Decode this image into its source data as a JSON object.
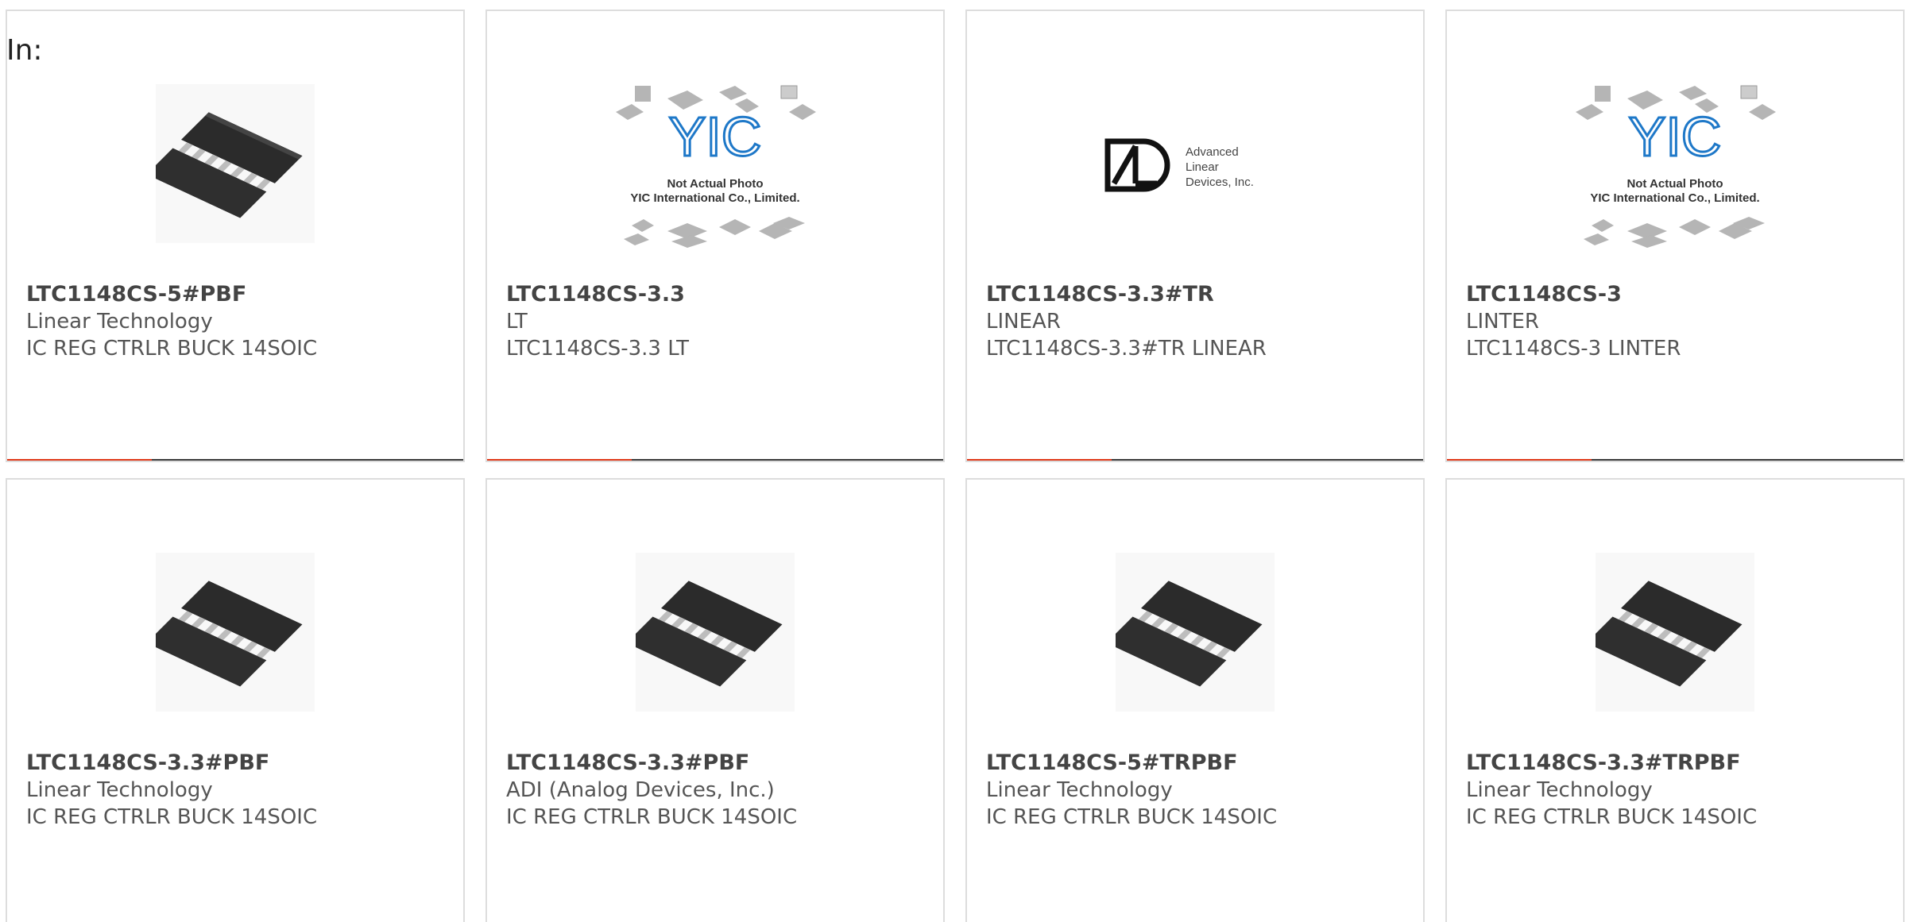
{
  "filter": {
    "in_label": "In:"
  },
  "products": [
    {
      "part": "LTC1148CS-5#PBF",
      "maker": "Linear Technology",
      "desc": "IC REG CTRLR BUCK 14SOIC",
      "image": "chip-icon"
    },
    {
      "part": "LTC1148CS-3.3",
      "maker": "LT",
      "desc": "LTC1148CS-3.3 LT",
      "image": "yic-placeholder",
      "placeholder_lines": [
        "Not Actual Photo",
        "YIC International Co., Limited."
      ]
    },
    {
      "part": "LTC1148CS-3.3#TR",
      "maker": "LINEAR",
      "desc": "LTC1148CS-3.3#TR LINEAR",
      "image": "ald-logo",
      "logo_lines": [
        "Advanced",
        "Linear",
        "Devices, Inc."
      ]
    },
    {
      "part": "LTC1148CS-3",
      "maker": "LINTER",
      "desc": "LTC1148CS-3 LINTER",
      "image": "yic-placeholder",
      "placeholder_lines": [
        "Not Actual Photo",
        "YIC International Co., Limited."
      ]
    },
    {
      "part": "LTC1148CS-3.3#PBF",
      "maker": "Linear Technology",
      "desc": "IC REG CTRLR BUCK 14SOIC",
      "image": "chip-icon"
    },
    {
      "part": "LTC1148CS-3.3#PBF",
      "maker": "ADI (Analog Devices, Inc.)",
      "desc": "IC REG CTRLR BUCK 14SOIC",
      "image": "chip-icon"
    },
    {
      "part": "LTC1148CS-5#TRPBF",
      "maker": "Linear Technology",
      "desc": "IC REG CTRLR BUCK 14SOIC",
      "image": "chip-icon"
    },
    {
      "part": "LTC1148CS-3.3#TRPBF",
      "maker": "Linear Technology",
      "desc": "IC REG CTRLR BUCK 14SOIC",
      "image": "chip-icon"
    }
  ],
  "colors": {
    "accent": "#e0391a",
    "bar": "#3c3c3c",
    "border": "#dddddd",
    "text": "#555555"
  }
}
